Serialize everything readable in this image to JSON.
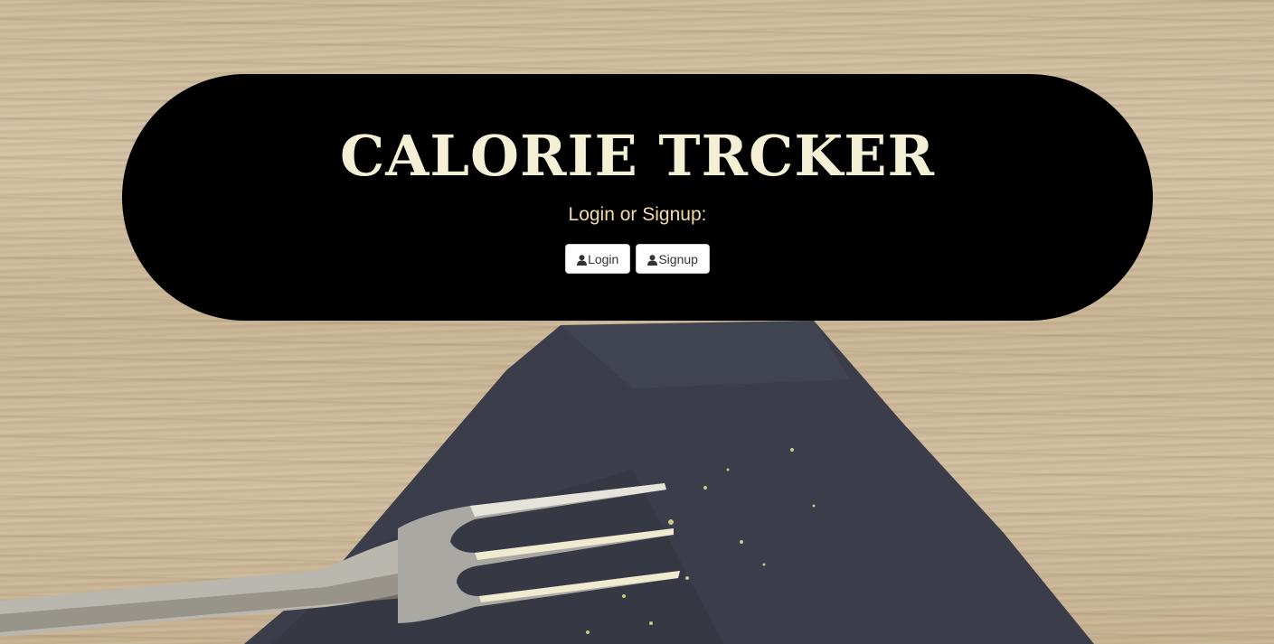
{
  "header": {
    "title": "CALORIE TRCKER",
    "subtitle": "Login or Signup:"
  },
  "actions": {
    "login_label": "Login",
    "signup_label": "Signup",
    "icon": "user-icon"
  },
  "background": {
    "description_icon": "fork-on-napkin-image"
  },
  "colors": {
    "title": "#f3f0d6",
    "subtitle": "#f5dca5",
    "panel": "#000000"
  }
}
